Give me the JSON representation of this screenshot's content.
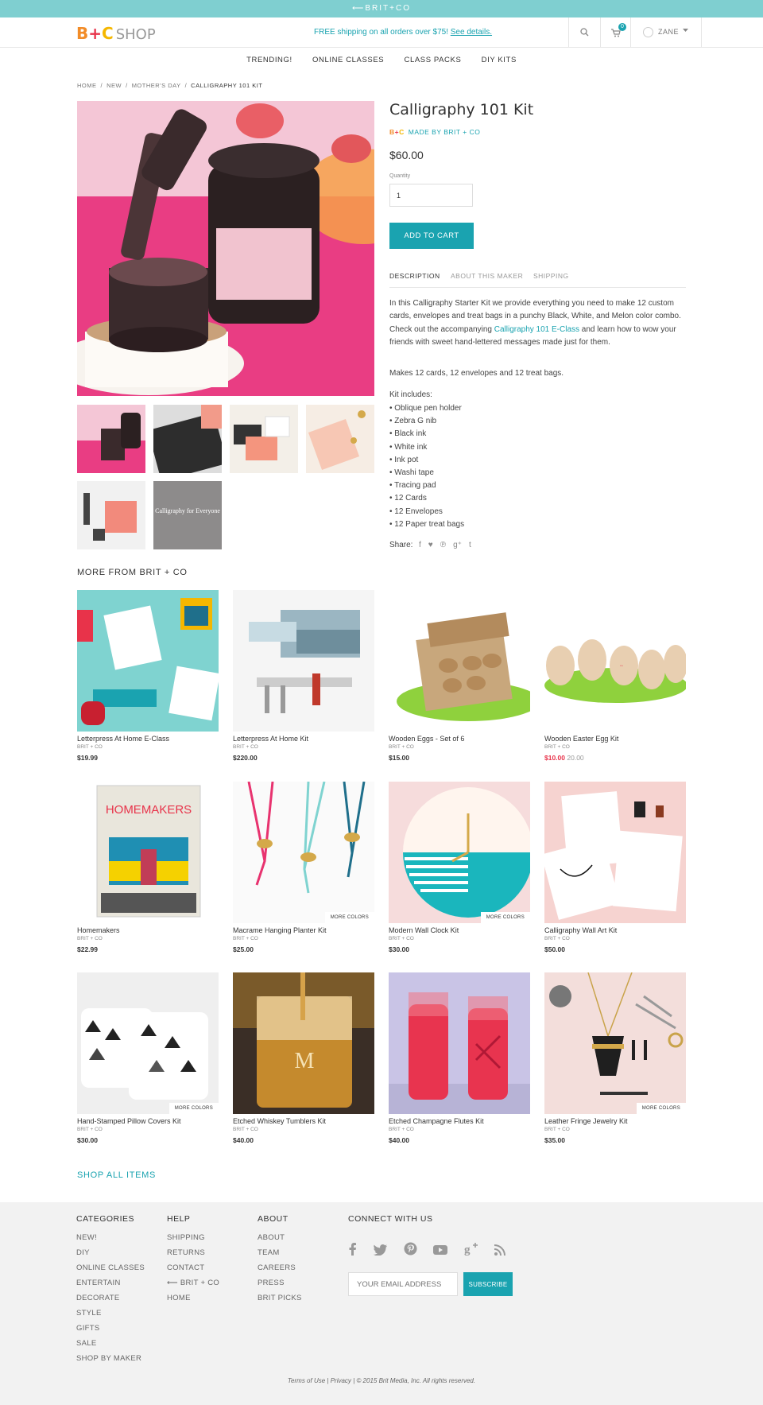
{
  "topbar": {
    "text": "⟵BRIT+CO"
  },
  "header": {
    "logo": {
      "b": "B",
      "plus": "+",
      "c": "C",
      "shop": "SHOP"
    },
    "promo": {
      "text": "FREE shipping on all orders over $75!",
      "link": "See details."
    },
    "cart_count": "0",
    "user_name": "ZANE"
  },
  "nav": [
    "TRENDING!",
    "ONLINE CLASSES",
    "CLASS PACKS",
    "DIY KITS"
  ],
  "breadcrumb": [
    "HOME",
    "/",
    "NEW",
    "/",
    "MOTHER'S DAY",
    "/",
    "CALLIGRAPHY 101 KIT"
  ],
  "product": {
    "title": "Calligraphy 101 Kit",
    "maker_prefix": {
      "b": "B",
      "plus": "+",
      "c": "C"
    },
    "maker": "MADE BY BRIT + CO",
    "price": "$60.00",
    "quantity_label": "Quantity",
    "quantity": "1",
    "add_to_cart": "ADD TO CART",
    "tabs": [
      "DESCRIPTION",
      "ABOUT THIS MAKER",
      "SHIPPING"
    ],
    "description_before": "In this Calligraphy Starter Kit we provide everything you need to make 12 custom cards, envelopes and treat bags in a punchy Black, White, and Melon color combo. Check out the accompanying ",
    "description_link": "Calligraphy 101 E-Class",
    "description_after": " and learn how to wow your friends with sweet hand-lettered messages made just for them.",
    "makes": "Makes 12 cards, 12 envelopes and 12 treat bags.",
    "kit_title": "Kit includes:",
    "kit_items": [
      "• Oblique pen holder",
      "• Zebra G nib",
      "• Black ink",
      "• White ink",
      "• Ink pot",
      "• Washi tape",
      "• Tracing pad",
      "• 12 Cards",
      "• 12 Envelopes",
      "• 12 Paper treat bags"
    ],
    "share_label": "Share:",
    "share_icons": [
      "facebook-icon",
      "twitter-icon",
      "pinterest-icon",
      "googleplus-icon",
      "tumblr-icon"
    ],
    "thumb_text": "Calligraphy for Everyone"
  },
  "more": {
    "title": "MORE FROM BRIT + CO",
    "items": [
      {
        "name": "Letterpress At Home E-Class",
        "brand": "BRIT + CO",
        "price": "$19.99",
        "more_colors": ""
      },
      {
        "name": "Letterpress At Home Kit",
        "brand": "BRIT + CO",
        "price": "$220.00",
        "more_colors": ""
      },
      {
        "name": "Wooden Eggs - Set of 6",
        "brand": "BRIT + CO",
        "price": "$15.00",
        "more_colors": ""
      },
      {
        "name": "Wooden Easter Egg Kit",
        "brand": "BRIT + CO",
        "price": "$10.00",
        "orig_price": "20.00",
        "more_colors": ""
      },
      {
        "name": "Homemakers",
        "brand": "BRIT + CO",
        "price": "$22.99",
        "more_colors": ""
      },
      {
        "name": "Macrame Hanging Planter Kit",
        "brand": "BRIT + CO",
        "price": "$25.00",
        "more_colors": "MORE COLORS"
      },
      {
        "name": "Modern Wall Clock Kit",
        "brand": "BRIT + CO",
        "price": "$30.00",
        "more_colors": "MORE COLORS"
      },
      {
        "name": "Calligraphy Wall Art Kit",
        "brand": "BRIT + CO",
        "price": "$50.00",
        "more_colors": ""
      },
      {
        "name": "Hand-Stamped Pillow Covers Kit",
        "brand": "BRIT + CO",
        "price": "$30.00",
        "more_colors": "MORE COLORS"
      },
      {
        "name": "Etched Whiskey Tumblers Kit",
        "brand": "BRIT + CO",
        "price": "$40.00",
        "more_colors": ""
      },
      {
        "name": "Etched Champagne Flutes Kit",
        "brand": "BRIT + CO",
        "price": "$40.00",
        "more_colors": ""
      },
      {
        "name": "Leather Fringe Jewelry Kit",
        "brand": "BRIT + CO",
        "price": "$35.00",
        "more_colors": "MORE COLORS"
      }
    ],
    "homemakers_cover": "HOMEMAKERS",
    "shop_all": "SHOP ALL ITEMS"
  },
  "footer": {
    "categories": {
      "title": "CATEGORIES",
      "items": [
        "NEW!",
        "DIY",
        "ONLINE CLASSES",
        "ENTERTAIN",
        "DECORATE",
        "STYLE",
        "GIFTS",
        "SALE",
        "SHOP BY MAKER"
      ]
    },
    "help": {
      "title": "HELP",
      "items": [
        "SHIPPING",
        "RETURNS",
        "CONTACT",
        "⟵ BRIT + CO",
        "HOME"
      ]
    },
    "about": {
      "title": "ABOUT",
      "items": [
        "ABOUT",
        "TEAM",
        "CAREERS",
        "PRESS",
        "BRIT PICKS"
      ]
    },
    "connect": {
      "title": "CONNECT WITH US",
      "icons": [
        "facebook-icon",
        "twitter-icon",
        "pinterest-icon",
        "youtube-icon",
        "googleplus-icon",
        "rss-icon"
      ]
    },
    "email_placeholder": "YOUR EMAIL ADDRESS",
    "subscribe": "SUBSCRIBE",
    "legal": "Terms of Use | Privacy | © 2015 Brit Media, Inc. All rights reserved."
  },
  "colors": {
    "accent": "#1aa3b0",
    "topbar": "#7fcfd0",
    "sale": "#e8334a"
  }
}
